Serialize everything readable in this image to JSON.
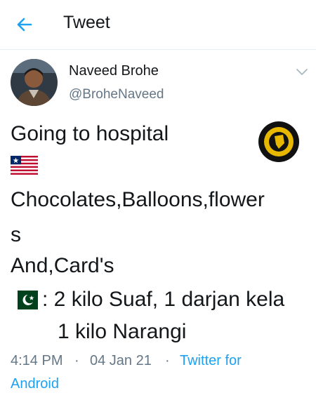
{
  "header": {
    "title": "Tweet",
    "back_icon": "arrow-left-icon"
  },
  "author": {
    "name": "Naveed Brohe",
    "handle": "@BroheNaveed"
  },
  "tweet": {
    "line1": "Going to hospital",
    "line2": "Chocolates,Balloons,flower",
    "line3": "s",
    "line4": "And,Card's",
    "line5": ": 2 kilo Suaf, 1 darjan kela",
    "line6": "1 kilo Narangi"
  },
  "meta": {
    "time": "4:14 PM",
    "dot1": "·",
    "date": "04 Jan 21",
    "dot2": "·",
    "source_line1": "Twitter for",
    "source_line2": "Android"
  },
  "colors": {
    "accent": "#1da1f2",
    "secondary": "#657786",
    "text": "#14171a"
  }
}
